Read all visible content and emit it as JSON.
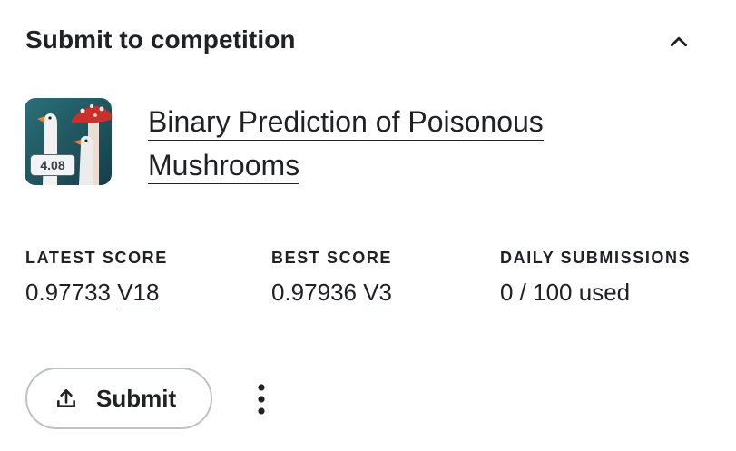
{
  "panel": {
    "title": "Submit to competition",
    "collapse_icon": "chevron-up-icon"
  },
  "competition": {
    "name": "Binary Prediction of Poisonous Mushrooms",
    "thumbnail_icon": "mushroom-geese-thumbnail",
    "badge": "4.08"
  },
  "stats": {
    "latest": {
      "label": "LATEST SCORE",
      "score": "0.97733",
      "version": "V18"
    },
    "best": {
      "label": "BEST SCORE",
      "score": "0.97936",
      "version": "V3"
    },
    "daily": {
      "label": "DAILY SUBMISSIONS",
      "value": "0 / 100 used"
    }
  },
  "actions": {
    "submit_label": "Submit",
    "submit_icon": "upload-icon",
    "more_icon": "more-vertical-icon"
  },
  "colors": {
    "text": "#202124",
    "button_border": "#bdc1c6",
    "thumbnail_bg": "#1f5a66",
    "mushroom_cap": "#c9302c"
  }
}
